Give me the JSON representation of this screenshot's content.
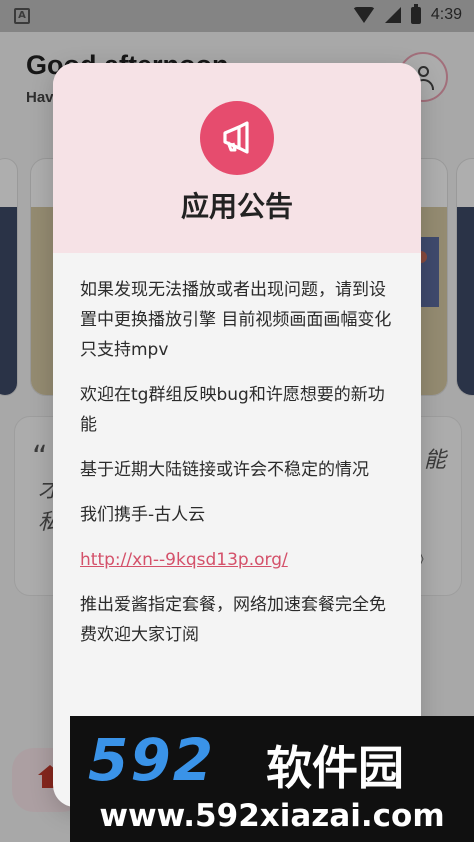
{
  "status_bar": {
    "notification_letter": "A",
    "time": "4:39",
    "icons": [
      "wifi-icon",
      "signal-icon",
      "battery-icon"
    ]
  },
  "background_app": {
    "greeting": "Good afternoon",
    "subtitle": "Hav",
    "quote_mark": "“",
    "quote_line1": "才",
    "quote_line2": "私",
    "quote_right": "能",
    "quote_book": "》"
  },
  "dialog": {
    "icon": "megaphone-icon",
    "title": "应用公告",
    "paragraphs": [
      "如果发现无法播放或者出现问题，请到设置中更换播放引擎 目前视频画面画幅变化只支持mpv",
      "欢迎在tg群组反映bug和许愿想要的新功能",
      "基于近期大陆链接或许会不稳定的情况",
      "我们携手-古人云"
    ],
    "link": "http://xn--9kqsd13p.org/",
    "footer_paragraph": "推出爱酱指定套餐，网络加速套餐完全免费欢迎大家订阅"
  },
  "watermark": {
    "number": "592",
    "name": "软件园",
    "url": "www.592xiazai.com"
  },
  "colors": {
    "accent": "#e64c6e",
    "header_bg": "#f6e2e6",
    "link": "#d4516a",
    "watermark_blue": "#3a93e8"
  }
}
